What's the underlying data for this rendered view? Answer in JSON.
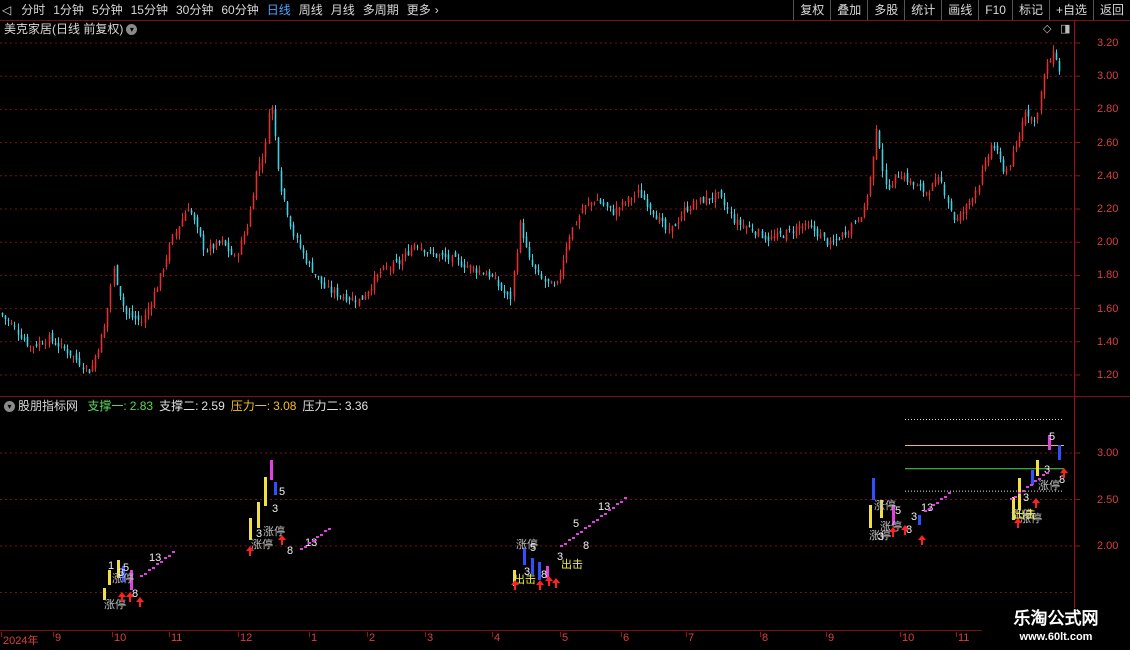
{
  "toolbar": {
    "tabs": [
      "分时",
      "1分钟",
      "5分钟",
      "15分钟",
      "30分钟",
      "60分钟",
      "日线",
      "周线",
      "月线",
      "多周期",
      "更多"
    ],
    "active_tab": "日线",
    "right_buttons": [
      "复权",
      "叠加",
      "多股",
      "统计",
      "画线",
      "F10",
      "标记",
      "+自选",
      "返回"
    ]
  },
  "main_panel": {
    "title": "美克家居(日线 前复权)",
    "y_ticks": [
      "3.20",
      "3.00",
      "2.80",
      "2.60",
      "2.40",
      "2.20",
      "2.00",
      "1.80",
      "1.60",
      "1.40",
      "1.20"
    ]
  },
  "indicator": {
    "name": "股朋指标网",
    "values": [
      {
        "label": "支撑一:",
        "value": "2.83",
        "color": "#58d858"
      },
      {
        "label": "支撑二:",
        "value": "2.59",
        "color": "#e0e0e0"
      },
      {
        "label": "压力一:",
        "value": "3.08",
        "color": "#f0c020"
      },
      {
        "label": "压力二:",
        "value": "3.36",
        "color": "#e0e0e0"
      }
    ],
    "y_ticks": [
      "3.00",
      "2.50",
      "2.00"
    ]
  },
  "x_axis": {
    "labels": [
      "2024年",
      "9",
      "10",
      "11",
      "12",
      "1",
      "2",
      "3",
      "4",
      "5",
      "6",
      "7",
      "8",
      "9",
      "10",
      "11"
    ]
  },
  "watermark": {
    "line1": "乐淘公式网",
    "line2": "www.60lt.com"
  },
  "signal_labels": {
    "limit_up": "涨停",
    "attack": "出击",
    "n1": "1",
    "n3": "3",
    "n5": "5",
    "n8": "8",
    "n13": "13"
  },
  "colors": {
    "up": "#e03030",
    "down": "#40d0e0",
    "grid": "#7a1010",
    "axis_text": "#d84040"
  },
  "chart_data": {
    "type": "candlestick",
    "series_name": "美克家居",
    "ylim": [
      1.1,
      3.25
    ],
    "price_path": [
      [
        0,
        1.57
      ],
      [
        12,
        1.5
      ],
      [
        30,
        1.37
      ],
      [
        48,
        1.42
      ],
      [
        66,
        1.35
      ],
      [
        90,
        1.22
      ],
      [
        105,
        1.5
      ],
      [
        113,
        1.85
      ],
      [
        125,
        1.57
      ],
      [
        142,
        1.52
      ],
      [
        158,
        1.75
      ],
      [
        172,
        2.02
      ],
      [
        188,
        2.22
      ],
      [
        205,
        1.95
      ],
      [
        222,
        2.0
      ],
      [
        235,
        1.9
      ],
      [
        248,
        2.12
      ],
      [
        257,
        2.45
      ],
      [
        265,
        2.55
      ],
      [
        270,
        2.9
      ],
      [
        280,
        2.35
      ],
      [
        293,
        2.05
      ],
      [
        305,
        1.9
      ],
      [
        325,
        1.72
      ],
      [
        340,
        1.68
      ],
      [
        360,
        1.65
      ],
      [
        380,
        1.82
      ],
      [
        400,
        1.88
      ],
      [
        415,
        2.0
      ],
      [
        430,
        1.93
      ],
      [
        450,
        1.9
      ],
      [
        470,
        1.85
      ],
      [
        490,
        1.8
      ],
      [
        510,
        1.65
      ],
      [
        520,
        2.12
      ],
      [
        528,
        1.9
      ],
      [
        540,
        1.78
      ],
      [
        556,
        1.72
      ],
      [
        568,
        2.03
      ],
      [
        582,
        2.2
      ],
      [
        596,
        2.26
      ],
      [
        612,
        2.18
      ],
      [
        638,
        2.3
      ],
      [
        652,
        2.2
      ],
      [
        668,
        2.05
      ],
      [
        685,
        2.2
      ],
      [
        700,
        2.25
      ],
      [
        718,
        2.28
      ],
      [
        735,
        2.12
      ],
      [
        752,
        2.08
      ],
      [
        768,
        2.02
      ],
      [
        785,
        2.05
      ],
      [
        800,
        2.1
      ],
      [
        815,
        2.07
      ],
      [
        830,
        1.98
      ],
      [
        848,
        2.08
      ],
      [
        864,
        2.2
      ],
      [
        872,
        2.45
      ],
      [
        877,
        2.7
      ],
      [
        885,
        2.32
      ],
      [
        900,
        2.42
      ],
      [
        912,
        2.35
      ],
      [
        925,
        2.3
      ],
      [
        940,
        2.38
      ],
      [
        955,
        2.12
      ],
      [
        965,
        2.2
      ],
      [
        978,
        2.35
      ],
      [
        992,
        2.6
      ],
      [
        1005,
        2.42
      ],
      [
        1015,
        2.55
      ],
      [
        1025,
        2.8
      ],
      [
        1035,
        2.72
      ],
      [
        1045,
        3.05
      ],
      [
        1055,
        3.15
      ],
      [
        1062,
        2.93
      ]
    ],
    "indicator_levels": {
      "support1": 2.83,
      "support2": 2.59,
      "resistance1": 3.08,
      "resistance2": 3.36
    }
  }
}
